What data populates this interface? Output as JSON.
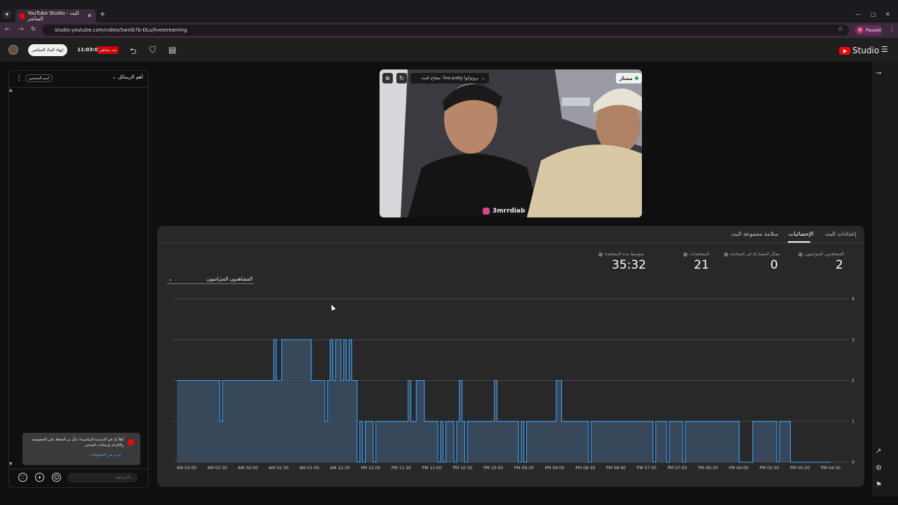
{
  "browser": {
    "tab_title": "YouTube Studio - البث المباشر",
    "url": "studio.youtube.com/video/Swxib7b-DLs/livestreaming",
    "paused_label": "Paused",
    "paused_initial": "3"
  },
  "header": {
    "end_stream_label": "إنهاء البثّ المباشر",
    "timer": "11:03:05",
    "live_badge": "بث مباشر",
    "logo_text": "Studio"
  },
  "chat": {
    "filter_label": "أهم الرسائل",
    "badge_label": "اسم المستبين",
    "notice_text": "أهلاً بك في الدردشة المباشرة! تذكّر بي الحفاظ على الخصوصية والالتزام بإرشادات المنتدى",
    "notice_link": "مزيد من المعلومات",
    "input_placeholder": "الدردشة..."
  },
  "video": {
    "quality_label": "ممتاز",
    "stream_key_label": "مفتاح البث: live pubg (بروتوكو",
    "instagram_handle": "3mrrdiab"
  },
  "tabs": [
    "إعدادات البث",
    "الإحصائيات",
    "سلامة مجموعة البث"
  ],
  "stats": [
    {
      "label": "المشاهدون المتزامنون",
      "value": "2"
    },
    {
      "label": "معدّل المشاركة في المحادثة",
      "value": "0"
    },
    {
      "label": "المشاهدات",
      "value": "21"
    },
    {
      "label": "متوسط مدة المشاهدة",
      "value": "35:32"
    }
  ],
  "metric_select": "المشاهدون المتزامنون",
  "chart_data": {
    "type": "area",
    "title": "",
    "xlabel": "",
    "ylabel": "",
    "ylim": [
      0,
      4
    ],
    "yticks": [
      0,
      1,
      2,
      3,
      4
    ],
    "xtick_labels": [
      "AM 03:00",
      "AM 02:30",
      "AM 02:00",
      "AM 01:30",
      "AM 01:00",
      "AM 12:30",
      "PM 12:00",
      "PM 11:30",
      "PM 11:00",
      "PM 10:30",
      "PM 10:00",
      "PM 09:30",
      "PM 09:00",
      "PM 08:30",
      "PM 08:00",
      "PM 07:30",
      "PM 07:00",
      "PM 06:30",
      "PM 06:00",
      "PM 05:30",
      "PM 05:00",
      "PM 04:30"
    ],
    "series": [
      {
        "values": [
          2,
          2,
          2,
          2,
          2,
          2,
          2,
          2,
          2,
          2,
          2,
          2,
          2,
          2,
          2,
          2,
          1,
          2,
          2,
          2,
          2,
          2,
          2,
          2,
          2,
          2,
          2,
          2,
          2,
          2,
          2,
          2,
          2,
          2,
          2,
          2,
          3,
          2,
          2,
          3,
          3,
          3,
          3,
          3,
          3,
          3,
          3,
          3,
          3,
          3,
          2,
          2,
          2,
          2,
          2,
          1,
          2,
          3,
          2,
          3,
          3,
          2,
          3,
          2,
          3,
          2,
          2,
          0,
          1,
          0,
          1,
          1,
          1,
          0,
          1,
          1,
          1,
          1,
          1,
          1,
          1,
          1,
          1,
          1,
          1,
          1,
          2,
          1,
          1,
          2,
          2,
          2,
          1,
          1,
          1,
          1,
          1,
          0,
          1,
          0,
          1,
          1,
          1,
          0,
          1,
          2,
          1,
          0,
          1,
          1,
          1,
          1,
          1,
          1,
          1,
          1,
          1,
          1,
          2,
          1,
          1,
          1,
          1,
          1,
          1,
          1,
          1,
          0,
          1,
          0,
          1,
          1,
          1,
          1,
          1,
          1,
          1,
          1,
          1,
          1,
          1,
          2,
          2,
          1,
          1,
          1,
          1,
          1,
          1,
          1,
          1,
          1,
          1,
          0,
          1,
          1,
          1,
          1,
          1,
          1,
          1,
          1,
          1,
          1,
          1,
          1,
          1,
          1,
          1,
          1,
          1,
          1,
          1,
          1,
          1,
          1,
          1,
          0,
          1,
          1,
          1,
          1,
          0,
          1,
          1,
          1,
          1,
          1,
          0,
          1,
          1,
          1,
          1,
          1,
          1,
          1,
          1,
          1,
          1,
          1,
          1,
          1,
          1,
          1,
          1,
          1,
          1,
          1,
          1,
          0,
          0,
          0,
          0,
          0,
          1,
          1,
          1,
          1,
          1,
          1,
          1,
          1,
          1,
          0,
          1,
          1,
          1,
          1,
          0,
          0,
          0,
          0,
          0,
          0,
          0,
          0,
          0,
          0,
          0,
          0,
          0,
          0,
          0
        ]
      }
    ],
    "colors": {
      "line": "#3ea6ff",
      "fill": "#3a4d63"
    }
  }
}
